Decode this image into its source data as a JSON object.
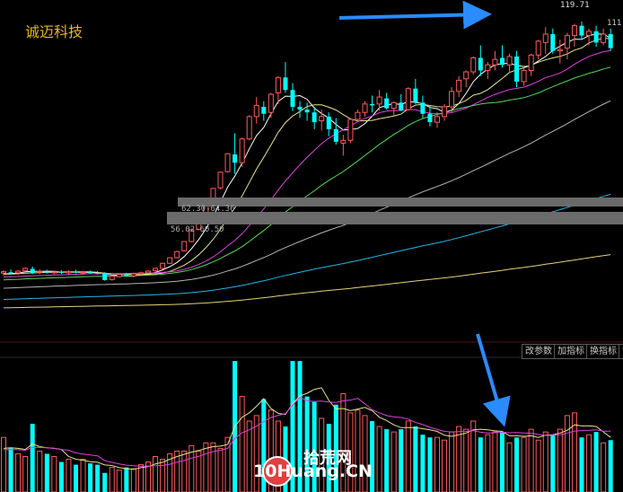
{
  "header": {
    "stock_name": "诚迈科技"
  },
  "price_labels": {
    "high": "119.71",
    "last": "111"
  },
  "bands": [
    {
      "label": "62.30-64.36"
    },
    {
      "label": "56.02-60.50"
    }
  ],
  "toolbar": {
    "buttons": [
      {
        "label": "改参数"
      },
      {
        "label": "加指标"
      },
      {
        "label": "换指标"
      },
      {
        "label": "?"
      }
    ]
  },
  "watermark": {
    "brand_cn": "拾荒网",
    "brand_en": "10Huang.CN"
  },
  "colors": {
    "up": "#ff5a5a",
    "down": "#00ffff",
    "ma_white": "#ffffff",
    "ma_yellow": "#e6e68c",
    "ma_magenta": "#e040e0",
    "ma_green": "#50dc50",
    "ma_gray": "#b4b4b4",
    "ma_cyan": "#28b4e6",
    "ma_gold": "#e6d27a",
    "arrow": "#2a8cff",
    "title": "#e6b428"
  },
  "chart_data": {
    "type": "candlestick",
    "ohlc": [
      [
        30.5,
        31.5,
        29.5,
        31.0
      ],
      [
        30.8,
        31.8,
        30.0,
        30.5
      ],
      [
        30.6,
        31.6,
        29.8,
        31.2
      ],
      [
        31.4,
        32.6,
        30.8,
        32.2
      ],
      [
        32.0,
        32.8,
        30.2,
        30.6
      ],
      [
        30.8,
        31.8,
        30.1,
        31.1
      ],
      [
        31.0,
        31.7,
        30.3,
        30.8
      ],
      [
        30.8,
        31.4,
        30.1,
        30.9
      ],
      [
        30.9,
        31.6,
        30.2,
        30.6
      ],
      [
        30.6,
        31.5,
        30.0,
        31.0
      ],
      [
        31.0,
        31.7,
        30.4,
        30.7
      ],
      [
        30.7,
        31.3,
        30.0,
        30.8
      ],
      [
        30.8,
        31.4,
        30.3,
        30.7
      ],
      [
        30.6,
        31.2,
        30.0,
        30.4
      ],
      [
        30.4,
        30.8,
        27.8,
        28.0
      ],
      [
        28.2,
        29.6,
        27.8,
        29.4
      ],
      [
        29.2,
        30.2,
        28.9,
        30.0
      ],
      [
        30.0,
        30.6,
        29.2,
        29.4
      ],
      [
        29.5,
        30.6,
        29.0,
        30.2
      ],
      [
        30.2,
        31.0,
        29.8,
        30.6
      ],
      [
        30.6,
        31.5,
        30.2,
        31.2
      ],
      [
        31.4,
        32.4,
        31.0,
        32.2
      ],
      [
        32.2,
        34.2,
        31.9,
        34.0
      ],
      [
        34.0,
        36.2,
        33.8,
        36.0
      ],
      [
        36.0,
        38.5,
        35.8,
        38.2
      ],
      [
        38.5,
        42.0,
        38.2,
        41.8
      ],
      [
        41.8,
        46.5,
        41.5,
        46.0
      ],
      [
        46.2,
        51.0,
        45.8,
        50.5
      ],
      [
        51.0,
        55.5,
        50.5,
        55.3
      ],
      [
        55.5,
        61.0,
        55.2,
        60.8
      ],
      [
        61.0,
        66.8,
        60.5,
        66.6
      ],
      [
        66.8,
        73.5,
        66.5,
        73.2
      ],
      [
        73.0,
        80.5,
        66.0,
        70.0
      ],
      [
        70.0,
        79.0,
        68.5,
        78.5
      ],
      [
        78.5,
        87.0,
        78.0,
        86.5
      ],
      [
        86.5,
        93.5,
        84.0,
        90.5
      ],
      [
        90.0,
        92.0,
        85.0,
        87.5
      ],
      [
        88.0,
        95.0,
        86.0,
        94.5
      ],
      [
        95.0,
        101.0,
        91.0,
        100.5
      ],
      [
        100.5,
        106.0,
        95.0,
        96.0
      ],
      [
        96.0,
        98.5,
        88.5,
        90.0
      ],
      [
        90.0,
        92.0,
        86.0,
        89.0
      ],
      [
        89.0,
        91.5,
        85.0,
        88.0
      ],
      [
        88.0,
        90.0,
        82.0,
        84.5
      ],
      [
        85.0,
        89.0,
        81.5,
        86.5
      ],
      [
        86.5,
        88.0,
        79.5,
        82.0
      ],
      [
        82.0,
        86.0,
        76.5,
        77.5
      ],
      [
        77.0,
        80.0,
        72.5,
        78.0
      ],
      [
        78.0,
        86.0,
        77.0,
        85.5
      ],
      [
        85.5,
        89.0,
        84.5,
        88.0
      ],
      [
        88.0,
        92.0,
        86.5,
        91.0
      ],
      [
        91.0,
        94.0,
        88.0,
        90.5
      ],
      [
        91.0,
        96.0,
        88.5,
        93.5
      ],
      [
        93.0,
        95.0,
        89.0,
        89.5
      ],
      [
        89.5,
        92.0,
        86.5,
        91.5
      ],
      [
        91.5,
        94.5,
        88.5,
        88.8
      ],
      [
        89.0,
        97.0,
        88.5,
        96.5
      ],
      [
        96.5,
        100.0,
        91.0,
        91.5
      ],
      [
        91.5,
        94.0,
        86.0,
        87.5
      ],
      [
        87.5,
        90.5,
        83.0,
        84.5
      ],
      [
        84.5,
        88.0,
        82.5,
        86.5
      ],
      [
        86.5,
        91.0,
        85.0,
        90.0
      ],
      [
        90.0,
        97.0,
        88.0,
        95.5
      ],
      [
        95.5,
        101.0,
        93.5,
        99.5
      ],
      [
        100.0,
        103.0,
        97.0,
        102.5
      ],
      [
        102.5,
        108.0,
        101.5,
        107.5
      ],
      [
        107.5,
        112.0,
        101.0,
        103.0
      ],
      [
        103.0,
        106.0,
        100.0,
        105.0
      ],
      [
        105.0,
        110.0,
        103.0,
        107.0
      ],
      [
        107.5,
        112.0,
        104.0,
        105.0
      ],
      [
        105.0,
        109.0,
        102.0,
        108.0
      ],
      [
        108.0,
        110.0,
        97.0,
        99.0
      ],
      [
        99.0,
        104.0,
        97.5,
        103.0
      ],
      [
        103.0,
        109.0,
        101.0,
        108.5
      ],
      [
        108.5,
        114.0,
        107.0,
        113.5
      ],
      [
        113.0,
        118.5,
        109.0,
        116.0
      ],
      [
        116.0,
        118.0,
        109.0,
        110.0
      ],
      [
        110.0,
        114.0,
        105.5,
        110.5
      ],
      [
        111.0,
        116.5,
        107.0,
        115.5
      ],
      [
        115.5,
        119.7,
        111.5,
        119.0
      ],
      [
        119.0,
        120.5,
        114.0,
        115.5
      ],
      [
        115.5,
        118.0,
        112.0,
        117.0
      ],
      [
        117.0,
        119.0,
        111.5,
        113.0
      ],
      [
        113.0,
        118.0,
        112.0,
        116.0
      ],
      [
        116.0,
        118.0,
        110.0,
        111.0
      ]
    ],
    "volume": [
      0.4,
      0.32,
      0.28,
      0.26,
      0.5,
      0.3,
      0.28,
      0.26,
      0.22,
      0.24,
      0.2,
      0.24,
      0.21,
      0.2,
      0.14,
      0.18,
      0.16,
      0.18,
      0.17,
      0.2,
      0.22,
      0.26,
      0.24,
      0.28,
      0.3,
      0.3,
      0.34,
      0.3,
      0.36,
      0.36,
      0.32,
      0.4,
      0.96,
      0.7,
      0.52,
      0.56,
      0.68,
      0.6,
      0.52,
      0.48,
      0.96,
      0.96,
      0.7,
      0.66,
      0.54,
      0.5,
      0.64,
      0.72,
      0.58,
      0.6,
      0.56,
      0.52,
      0.48,
      0.46,
      0.44,
      0.46,
      0.52,
      0.48,
      0.42,
      0.4,
      0.4,
      0.38,
      0.44,
      0.48,
      0.46,
      0.52,
      0.4,
      0.42,
      0.44,
      0.44,
      0.36,
      0.4,
      0.4,
      0.46,
      0.38,
      0.44,
      0.42,
      0.46,
      0.56,
      0.58,
      0.4,
      0.42,
      0.44,
      0.36,
      0.38
    ],
    "ma_periods": [
      5,
      10,
      20,
      30,
      60,
      120,
      250
    ],
    "ylim": [
      10,
      125
    ]
  }
}
